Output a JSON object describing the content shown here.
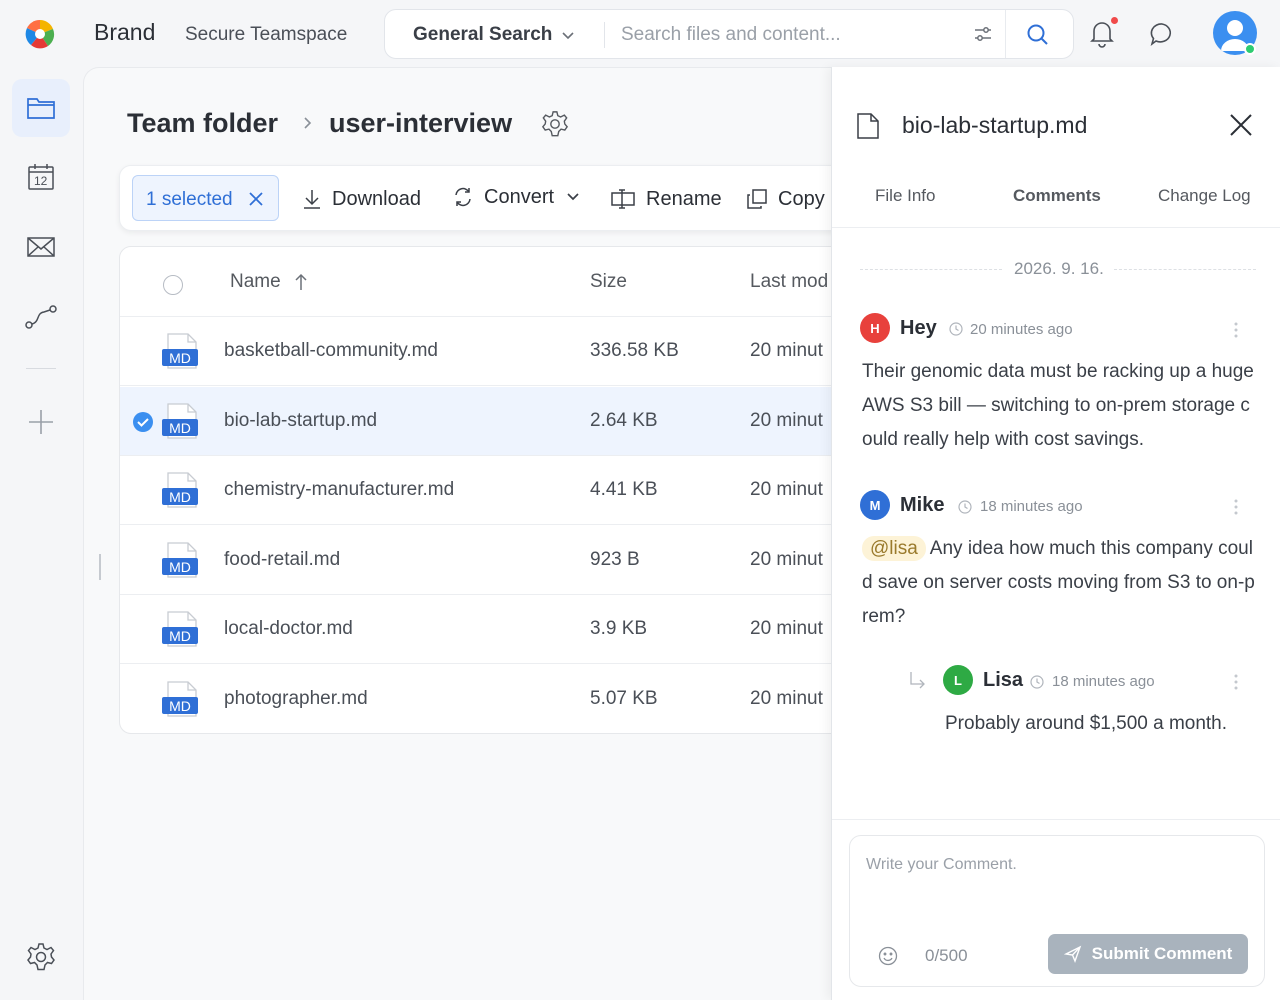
{
  "header": {
    "brand": "Brand",
    "teamspace": "Secure Teamspace",
    "search_scope": "General Search",
    "search_placeholder": "Search files and content..."
  },
  "rail": {
    "items": [
      "folder-icon",
      "calendar-icon",
      "mail-icon",
      "route-icon",
      "plus-icon",
      "gear-icon"
    ],
    "calendar_day": "12"
  },
  "breadcrumb": {
    "root": "Team folder",
    "current": "user-interview"
  },
  "toolbar": {
    "selected_label": "1 selected",
    "download_label": "Download",
    "convert_label": "Convert",
    "rename_label": "Rename",
    "copy_label": "Copy"
  },
  "table": {
    "columns": {
      "name": "Name",
      "size": "Size",
      "modified": "Last mod"
    },
    "icon_label": "MD",
    "rows": [
      {
        "name": "basketball-community.md",
        "size": "336.58 KB",
        "modified": "20 minut",
        "selected": false
      },
      {
        "name": "bio-lab-startup.md",
        "size": "2.64 KB",
        "modified": "20 minut",
        "selected": true
      },
      {
        "name": "chemistry-manufacturer.md",
        "size": "4.41 KB",
        "modified": "20 minut",
        "selected": false
      },
      {
        "name": "food-retail.md",
        "size": "923 B",
        "modified": "20 minut",
        "selected": false
      },
      {
        "name": "local-doctor.md",
        "size": "3.9 KB",
        "modified": "20 minut",
        "selected": false
      },
      {
        "name": "photographer.md",
        "size": "5.07 KB",
        "modified": "20 minut",
        "selected": false
      }
    ]
  },
  "panel": {
    "filename": "bio-lab-startup.md",
    "tabs": [
      "File Info",
      "Comments",
      "Change Log"
    ],
    "active_tab": "Comments",
    "date": "2026. 9. 16.",
    "comments": [
      {
        "initial": "H",
        "name": "Hey",
        "time": "20 minutes ago",
        "color": "#e8413c",
        "text": "Their genomic data must be racking up a huge AWS S3 bill — switching to on-prem storage could really help with cost savings."
      },
      {
        "initial": "M",
        "name": "Mike",
        "time": "18 minutes ago",
        "color": "#2f6fd6",
        "mention": "@lisa",
        "text": "Any idea how much this company could save on server costs moving from S3 to on-prem?"
      },
      {
        "initial": "L",
        "name": "Lisa",
        "time": "18 minutes ago",
        "color": "#2eaa44",
        "text": "Probably around $1,500 a month.",
        "reply": true
      }
    ],
    "compose_placeholder": "Write your Comment.",
    "counter": "0/500",
    "submit_label": "Submit Comment"
  },
  "colors": {
    "accent": "#2f6fd6",
    "selected_row": "#eef4fe",
    "mention_bg": "#fdf3d7",
    "submit_disabled": "#a9b3bd",
    "online": "#2ecc71",
    "notification": "#f04a4a"
  }
}
